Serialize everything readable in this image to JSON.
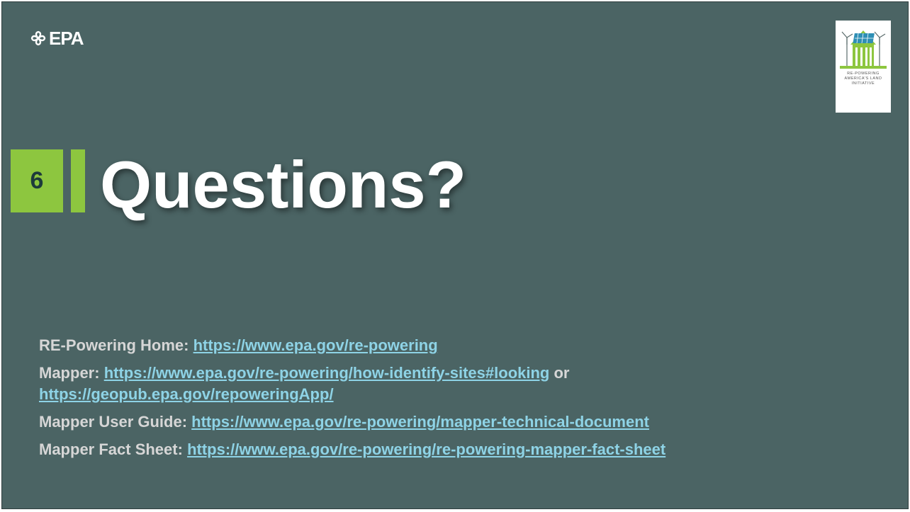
{
  "header": {
    "epa_logo_text": "EPA",
    "initiative_logo_caption": [
      "RE-POWERING",
      "AMERICA'S LAND",
      "INITIATIVE"
    ]
  },
  "section": {
    "number": "6",
    "title": "Questions?"
  },
  "resources": [
    {
      "label": "RE-Powering Home:",
      "link": "https://www.epa.gov/re-powering"
    },
    {
      "label": "Mapper:",
      "link": "https://www.epa.gov/re-powering/how-identify-sites#looking",
      "connector": "or",
      "link2": "https://geopub.epa.gov/repoweringApp/"
    },
    {
      "label": "Mapper User Guide:",
      "link": "https://www.epa.gov/re-powering/mapper-technical-document"
    },
    {
      "label": "Mapper Fact Sheet:",
      "link": "https://www.epa.gov/re-powering/re-powering-mapper-fact-sheet"
    }
  ],
  "colors": {
    "background": "#4b6464",
    "accent_green": "#8dc63f",
    "link": "#8ed3e6"
  },
  "icons": {
    "epa": "epa-flower-icon",
    "initiative": "solar-wind-house-icon"
  }
}
